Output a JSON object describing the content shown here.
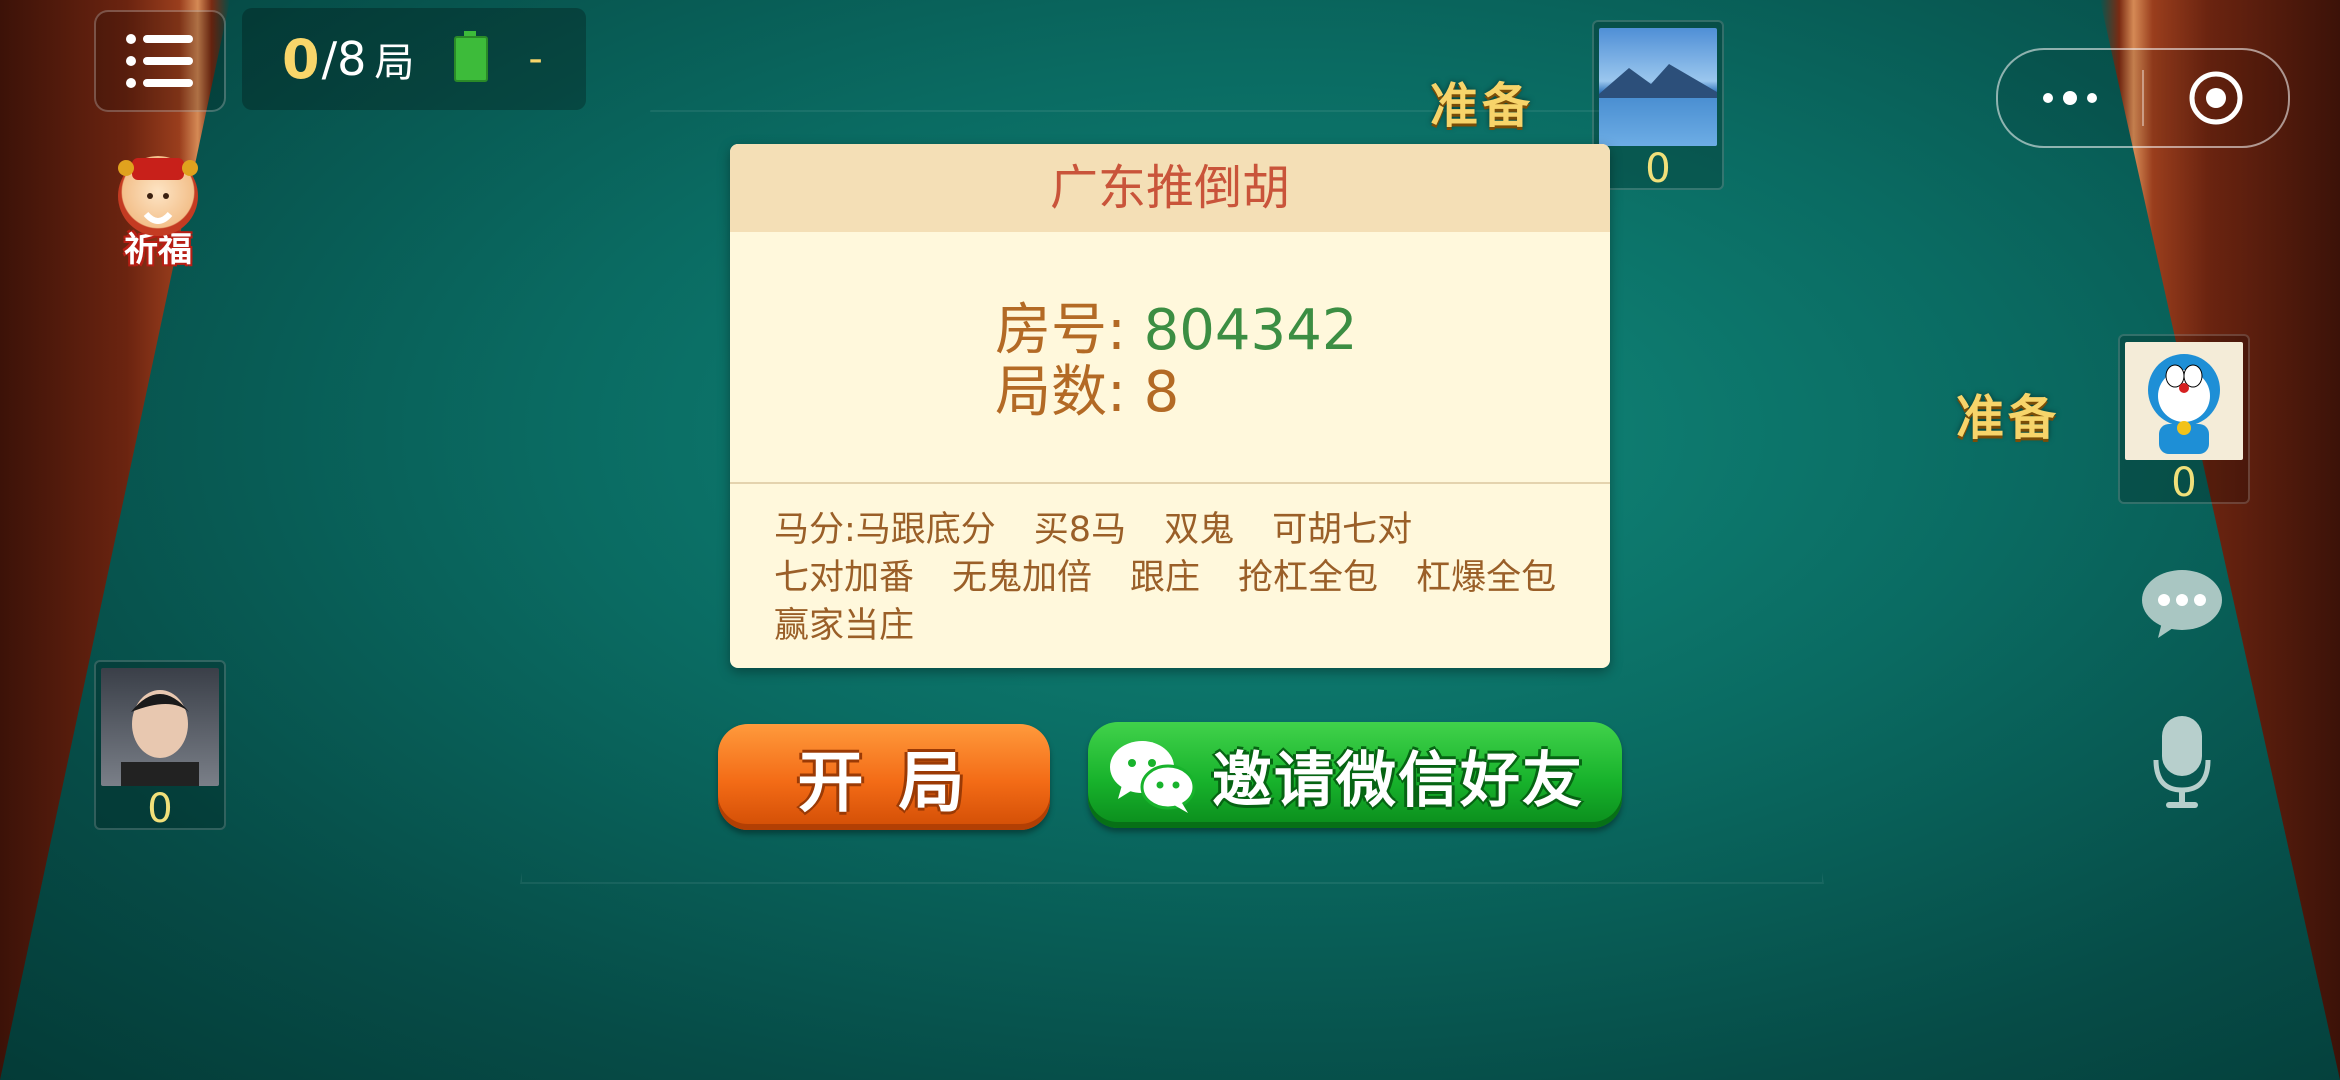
{
  "hud": {
    "round_current": "0",
    "round_total": "/8",
    "round_unit": "局",
    "signal": "-",
    "blessing_label": "祈福"
  },
  "players": {
    "top": {
      "status": "准备",
      "score": "0"
    },
    "right": {
      "status": "准备",
      "score": "0"
    },
    "left": {
      "score": "0"
    }
  },
  "room": {
    "title": "广东推倒胡",
    "room_label": "房号: ",
    "room_number": "804342",
    "rounds_label": "局数: ",
    "rounds_value": "8",
    "rules": [
      "马分:马跟底分",
      "买8马",
      "双鬼",
      "可胡七对",
      "七对加番",
      "无鬼加倍",
      "跟庄",
      "抢杠全包",
      "杠爆全包",
      "赢家当庄"
    ]
  },
  "buttons": {
    "start": "开 局",
    "invite": "邀请微信好友"
  },
  "colors": {
    "table_felt": "#0a6b62",
    "start_button": "#f36b16",
    "invite_button": "#18b32c",
    "ready_text": "#f7d46a",
    "room_number": "#3c8e43"
  }
}
